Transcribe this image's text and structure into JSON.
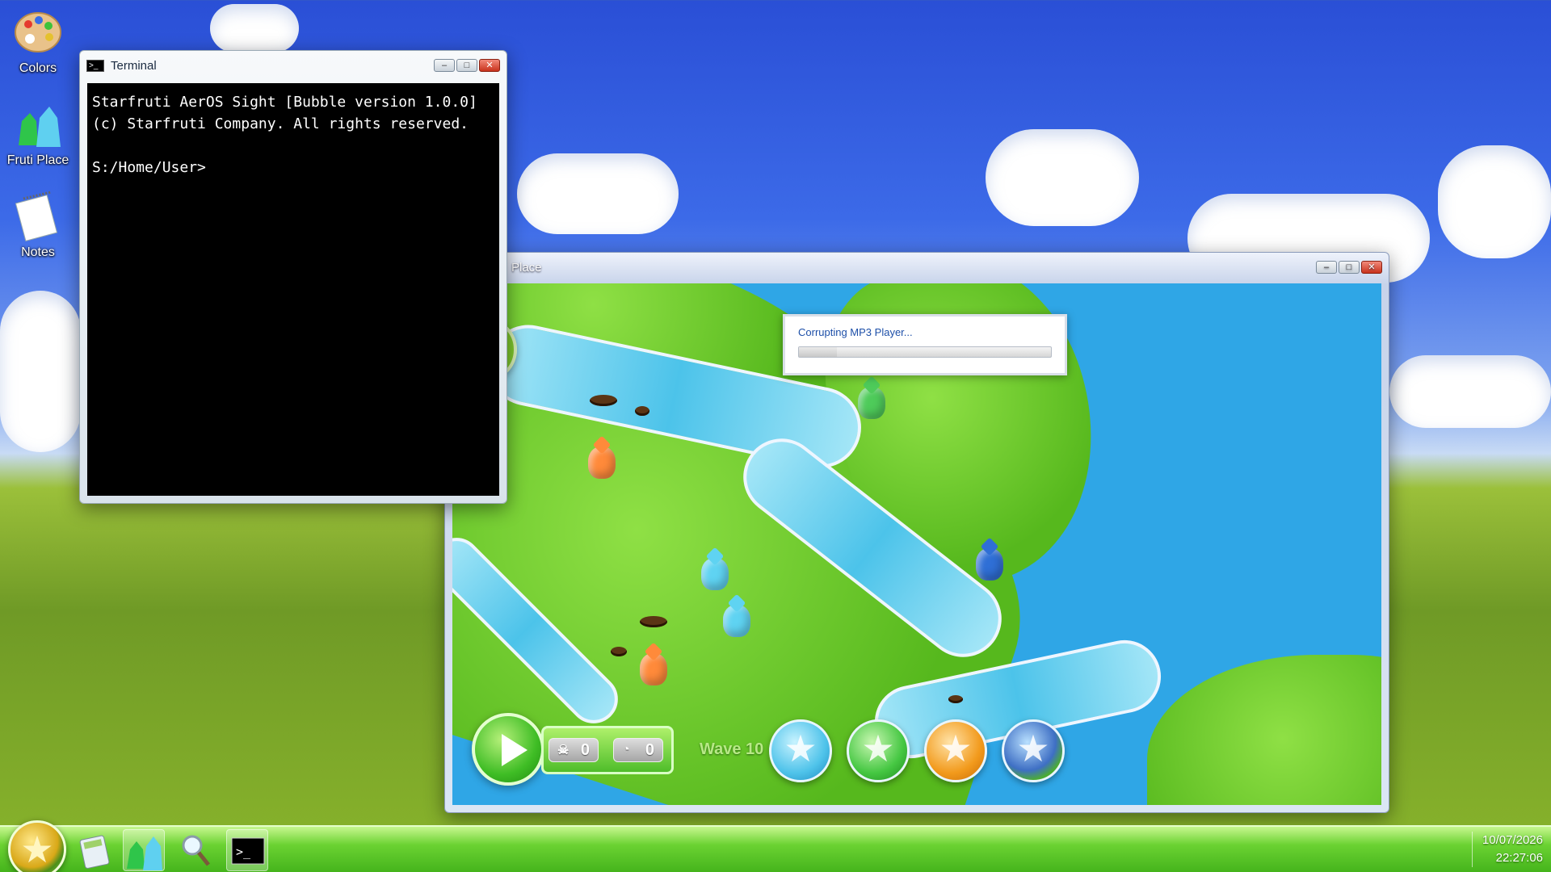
{
  "desktop": {
    "icons": [
      {
        "label": "Colors",
        "icon": "palette-icon"
      },
      {
        "label": "Fruti Place",
        "icon": "fruti-place-icon"
      },
      {
        "label": "Notes",
        "icon": "notepad-icon"
      }
    ]
  },
  "terminal": {
    "title": "Terminal",
    "lines": [
      "Starfruti AerOS Sight [Bubble version 1.0.0]",
      "(c) Starfruti Company. All rights reserved.",
      "",
      "S:/Home/User>"
    ]
  },
  "fruti_window": {
    "title": "Place"
  },
  "dialog": {
    "message": "Corrupting MP3 Player...",
    "progress": 0.15
  },
  "hud": {
    "kills": "0",
    "coins": "0",
    "kills_icon": "skull-icon",
    "coins_icon": "coin-icon",
    "wave": "Wave 10",
    "towers": [
      {
        "name": "blue-star-tower",
        "color": "#4fc3ea"
      },
      {
        "name": "green-star-tower",
        "color": "#45c742"
      },
      {
        "name": "orange-star-tower",
        "color": "#f29a1c"
      },
      {
        "name": "earth-star-tower",
        "color": "#3e6fc4"
      }
    ]
  },
  "taskbar": {
    "start_icon": "star-icon",
    "items": [
      "calculator-icon",
      "fruti-place-icon",
      "search-icon",
      "terminal-icon"
    ],
    "date": "10/07/2026",
    "time": "22:27:06"
  }
}
